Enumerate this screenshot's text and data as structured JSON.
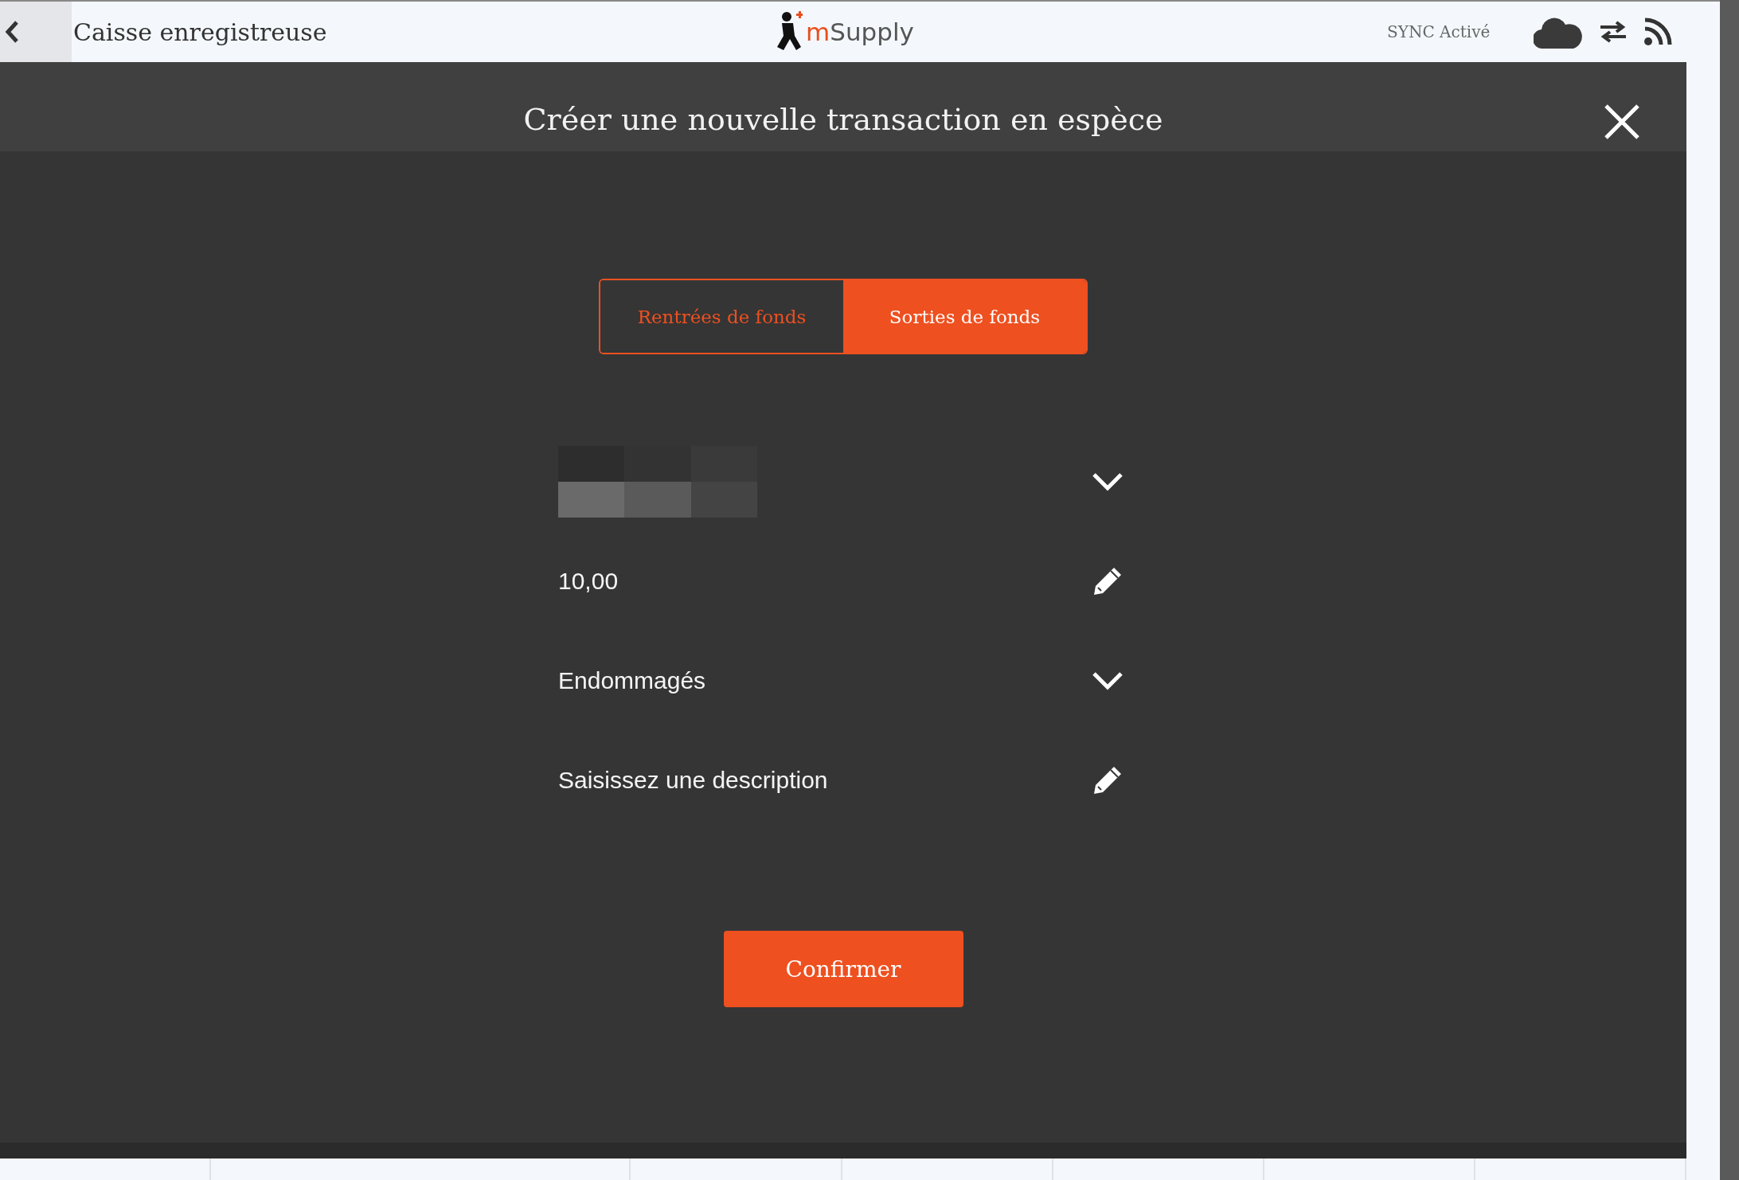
{
  "header": {
    "title": "Caisse enregistreuse",
    "logo": {
      "mark": "m",
      "text": "Supply"
    },
    "sync_status": "SYNC Activé"
  },
  "modal": {
    "title": "Créer une nouvelle transaction en espèce",
    "segments": [
      {
        "label": "Rentrées de fonds",
        "selected": false
      },
      {
        "label": "Sorties de fonds",
        "selected": true
      }
    ],
    "fields": [
      {
        "kind": "select",
        "obscured": true
      },
      {
        "kind": "input",
        "value": "10,00"
      },
      {
        "kind": "select",
        "value": "Endommagés"
      },
      {
        "kind": "input",
        "placeholder": "Saisissez une description"
      }
    ],
    "confirm_button": "Confirmer"
  }
}
